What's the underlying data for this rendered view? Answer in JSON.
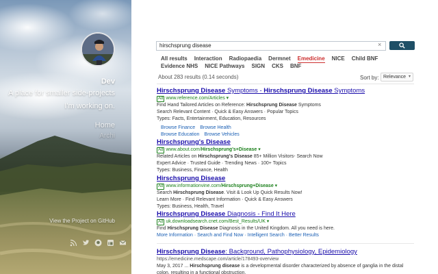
{
  "hero": {
    "name": "Dev",
    "tagline_1": "A place for smaller side-projects",
    "tagline_2": "I'm working on.",
    "nav_home": "Home",
    "nav_archive": "Archi",
    "project_link": "View the Project on GitHub",
    "social_icons": [
      "rss-icon",
      "twitter-icon",
      "github-icon",
      "linkedin-icon",
      "email-icon"
    ]
  },
  "search": {
    "query": "hirschsprung disease",
    "clear_icon": "×",
    "button_icon": "search-icon"
  },
  "tabs": {
    "row1": [
      "All results",
      "Interaction",
      "Radiopaedia",
      "Dermnet",
      "Emedicine",
      "NICE",
      "Child BNF"
    ],
    "row2": [
      "Evidence NHS",
      "NICE Pathways",
      "SIGN",
      "CKS",
      "BNF"
    ],
    "active": "Emedicine"
  },
  "meta": {
    "result_count": "About 283 results (0.14 seconds)",
    "sort_label": "Sort by:",
    "sort_value": "Relevance"
  },
  "results": [
    {
      "title_parts": [
        [
          "Hirschsprung Disease",
          true
        ],
        [
          " Symptoms - ",
          false
        ],
        [
          "Hirschsprung Disease",
          true
        ],
        [
          " Symptoms",
          false
        ]
      ],
      "ad": "Ad",
      "url_parts": [
        [
          "www.reference.com/Articles ▾",
          false
        ]
      ],
      "lines": [
        [
          [
            "Find Hand Tailored Articles on Reference: ",
            false
          ],
          [
            "Hirschsprung Disease",
            true
          ],
          [
            " Symptoms",
            false
          ]
        ],
        [
          [
            "Search Relevant Content · Quick & Easy Answers · Popular Topics",
            false
          ]
        ],
        [
          [
            "Types: Facts, Entertainment, Education, Resources",
            false
          ]
        ]
      ],
      "links": [
        [
          "Browse Finance",
          "Browse Health"
        ],
        [
          "Browse Education",
          "Browse Vehicles"
        ]
      ]
    },
    {
      "title_parts": [
        [
          "Hirschsprung's Disease",
          true
        ]
      ],
      "ad": "Ad",
      "url_parts": [
        [
          "www.about.com/",
          false
        ],
        [
          "Hirschsprung's+Disease",
          true
        ],
        [
          " ▾",
          false
        ]
      ],
      "lines": [
        [
          [
            "Related Articles on ",
            false
          ],
          [
            "Hirschsprung's Disease",
            true
          ],
          [
            " 85+ Million Visitors- Search Now",
            false
          ]
        ],
        [
          [
            "Expert Advice · Trusted Guide · Trending News · 100+ Topics",
            false
          ]
        ],
        [
          [
            "Types: Business, Finance, Health",
            false
          ]
        ]
      ],
      "links": []
    },
    {
      "title_parts": [
        [
          "Hirschsprung Disease",
          true
        ]
      ],
      "ad": "Ad",
      "url_parts": [
        [
          "www.informationvine.com/",
          false
        ],
        [
          "Hirschsprung+Disease",
          true
        ],
        [
          " ▾",
          false
        ]
      ],
      "lines": [
        [
          [
            "Search ",
            false
          ],
          [
            "Hirschsprung Disease",
            true
          ],
          [
            ". Visit & Look Up Quick Results Now!",
            false
          ]
        ],
        [
          [
            "Learn More · Find Relevant Information · Quick & Easy Answers",
            false
          ]
        ],
        [
          [
            "Types: Business, Health, Travel",
            false
          ]
        ]
      ],
      "links": []
    },
    {
      "title_parts": [
        [
          "Hirschsprung Disease",
          true
        ],
        [
          " Diagnosis - Find It Here",
          false
        ]
      ],
      "ad": "Ad",
      "url_parts": [
        [
          "uk.downloadsearch.cnet.com/Best_Results/UK ▾",
          false
        ]
      ],
      "lines": [
        [
          [
            "Find ",
            false
          ],
          [
            "Hirschsprung Disease",
            true
          ],
          [
            " Diagnosis in the United Kingdom. All you need is here.",
            false
          ]
        ]
      ],
      "inline_links": "More Information · Search and Find Now · Intelligent Search · Better Results"
    },
    {
      "title_parts": [
        [
          "Hirschsprung Disease",
          true
        ],
        [
          ": Background, Pathophysiology, Epidemiology",
          false
        ]
      ],
      "ad": "",
      "url_parts": [
        [
          "https://emedicine.medscape.com/article/178493-overview",
          false
        ]
      ],
      "lines": [
        [
          [
            "May 3, 2017 ... ",
            false
          ],
          [
            "Hirschsprung disease",
            true
          ],
          [
            " is a developmental disorder characterized by absence of ganglia in the distal colon, resulting in a functional obstruction.",
            false
          ]
        ]
      ],
      "links": []
    }
  ],
  "colors": {
    "link": "#1a0dab",
    "url_green": "#1a7f1a",
    "active_tab": "#cc2e2e",
    "search_button": "#1f4f66"
  }
}
